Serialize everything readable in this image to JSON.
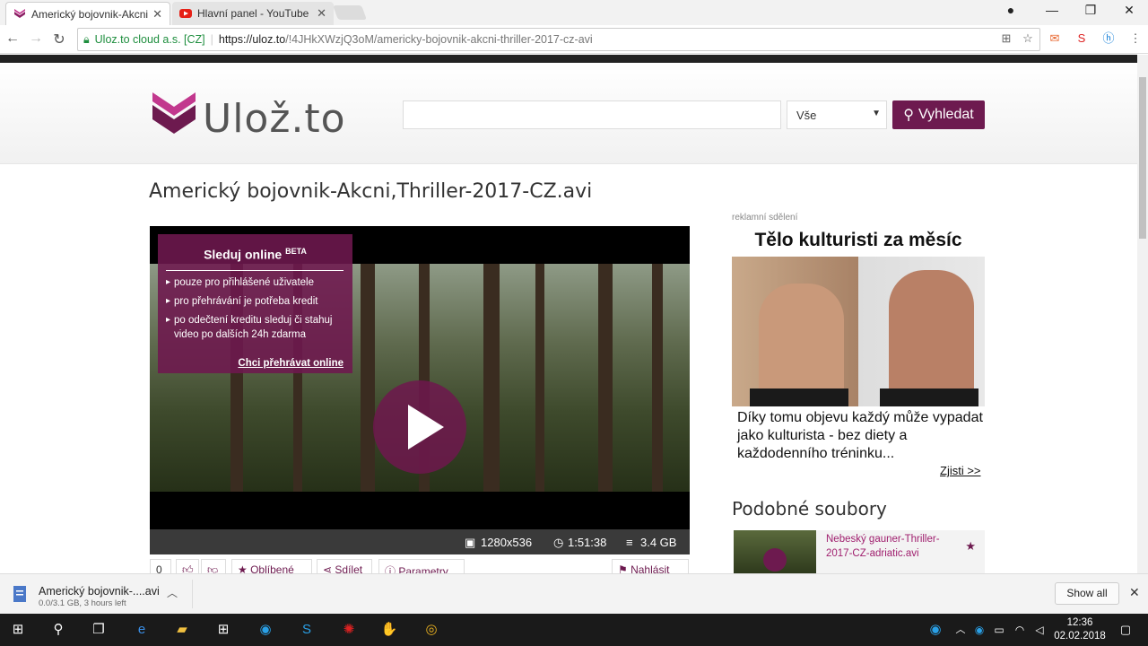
{
  "browser": {
    "tabs": [
      {
        "title": "Americký bojovnik-Akcni"
      },
      {
        "title": "Hlavní panel - YouTube"
      }
    ],
    "address": {
      "site_identity": "Uloz.to cloud a.s. [CZ]",
      "url_scheme_host": "https://uloz.to",
      "url_path": "/!4JHkXWzjQ3oM/americky-bojovnik-akcni-thriller-2017-cz-avi"
    }
  },
  "header": {
    "logo_text": "Ulož.to",
    "search_placeholder": "",
    "search_category": "Vše",
    "search_button": "Vyhledat"
  },
  "file": {
    "title": "Americký bojovnik-Akcni,Thriller-2017-CZ.avi",
    "resolution": "1280x536",
    "duration": "1:51:38",
    "size": "3.4 GB"
  },
  "overlay": {
    "heading": "Sleduj online",
    "badge": "BETA",
    "bullets": [
      "pouze pro přihlášené uživatele",
      "pro přehrávání je potřeba kredit",
      "po odečtení kreditu sleduj či stahuj video po dalších 24h zdarma"
    ],
    "link": "Chci přehrávat online"
  },
  "actions": {
    "count": "0",
    "favorite": "Oblíbené",
    "share": "Sdílet",
    "params": "Parametry",
    "report": "Nahlásit"
  },
  "ad": {
    "label": "reklamní sdělení",
    "title": "Tělo kulturisti za měsíc",
    "text": "Díky tomu objevu každý může vypadat jako kulturista - bez diety a každodenního tréninku...",
    "link": "Zjisti >>"
  },
  "similar": {
    "title": "Podobné soubory",
    "items": [
      {
        "name": "Nebeský gauner-Thriller-2017-CZ-adriatic.avi"
      }
    ]
  },
  "download": {
    "filename": "Americký bojovnik-....avi",
    "status": "0.0/3.1 GB, 3 hours left",
    "show_all": "Show all"
  },
  "taskbar": {
    "time": "12:36",
    "date": "02.02.2018"
  },
  "colors": {
    "brand": "#6d1a4f",
    "brand_overlay": "#6e184e"
  }
}
